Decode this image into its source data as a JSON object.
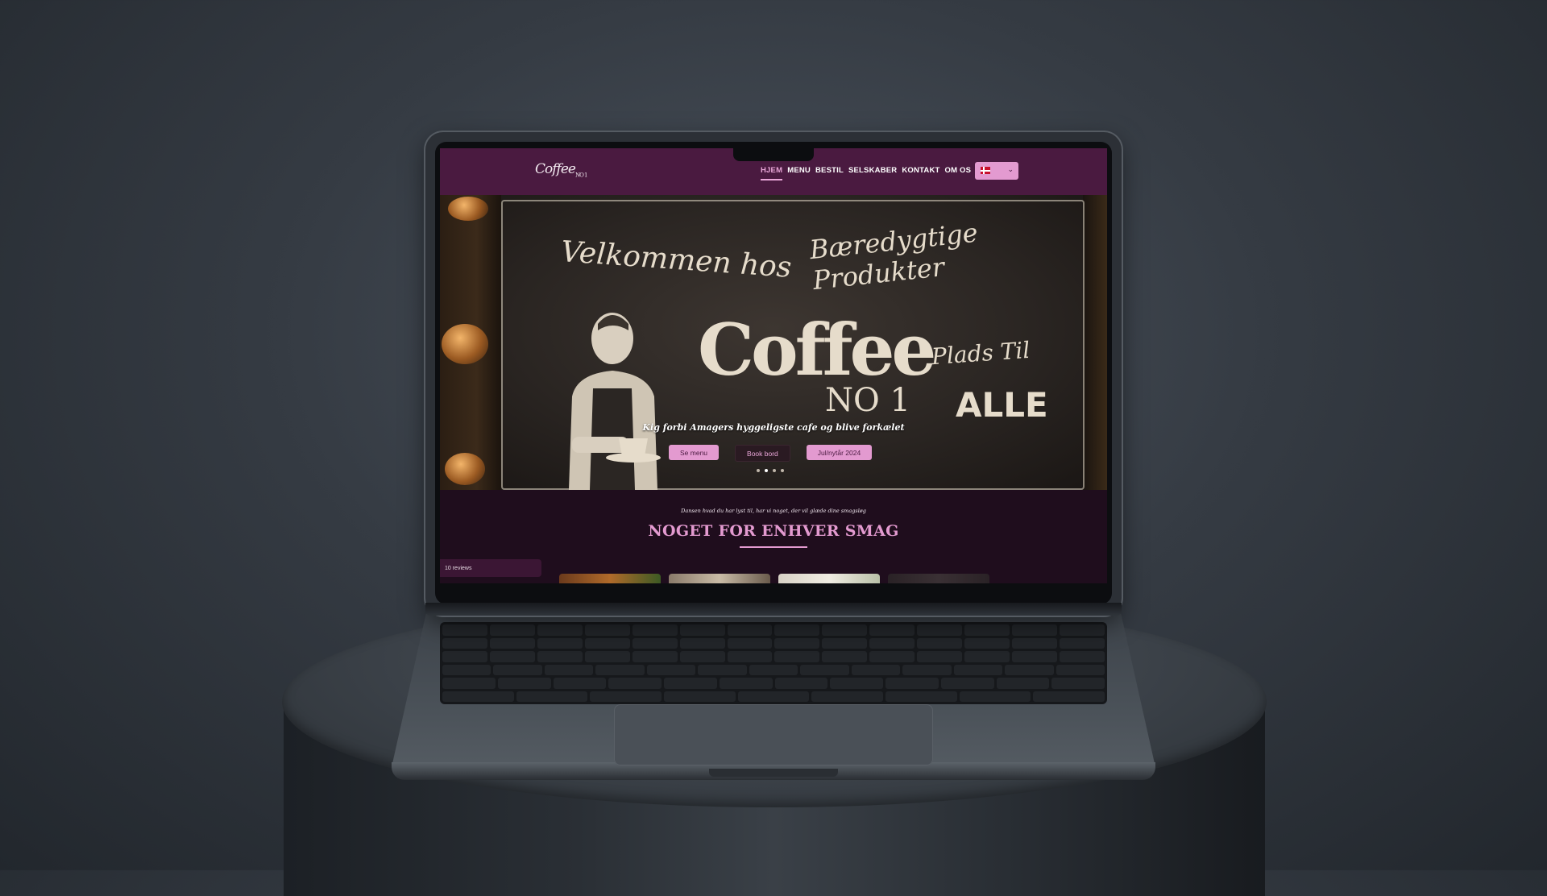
{
  "site": {
    "logo_text": "Coffee",
    "logo_sub": "NO 1",
    "nav": [
      {
        "label": "HJEM",
        "active": true
      },
      {
        "label": "MENU",
        "active": false
      },
      {
        "label": "BESTIL",
        "active": false
      },
      {
        "label": "SELSKABER",
        "active": false
      },
      {
        "label": "KONTAKT",
        "active": false
      },
      {
        "label": "OM OS",
        "active": false
      }
    ],
    "language": {
      "flag": "danish-flag-icon",
      "caret": "⌄"
    }
  },
  "hero": {
    "chalk": {
      "welcome": "Velkommen hos",
      "coffee": "Coffee",
      "no1": "NO 1",
      "products": "Bæredygtige Produkter",
      "room": "Plads Til",
      "all": "ALLE"
    },
    "tagline": "Kig forbi Amagers hyggeligste cafe og blive forkælet",
    "buttons": [
      {
        "label": "Se menu"
      },
      {
        "label": "Book bord"
      },
      {
        "label": "Jul/nytår 2024"
      }
    ],
    "slides": 4,
    "active_slide": 1
  },
  "section": {
    "intro": "Dansen hvad du har lyst til, har vi noget, der vil glæde dine smagsløg",
    "title": "NOGET FOR ENHVER SMAG",
    "reviews_label": "10 reviews"
  },
  "colors": {
    "header": "#4a1a40",
    "accent": "#e39ad0",
    "page_bg": "#1f0d1d"
  }
}
